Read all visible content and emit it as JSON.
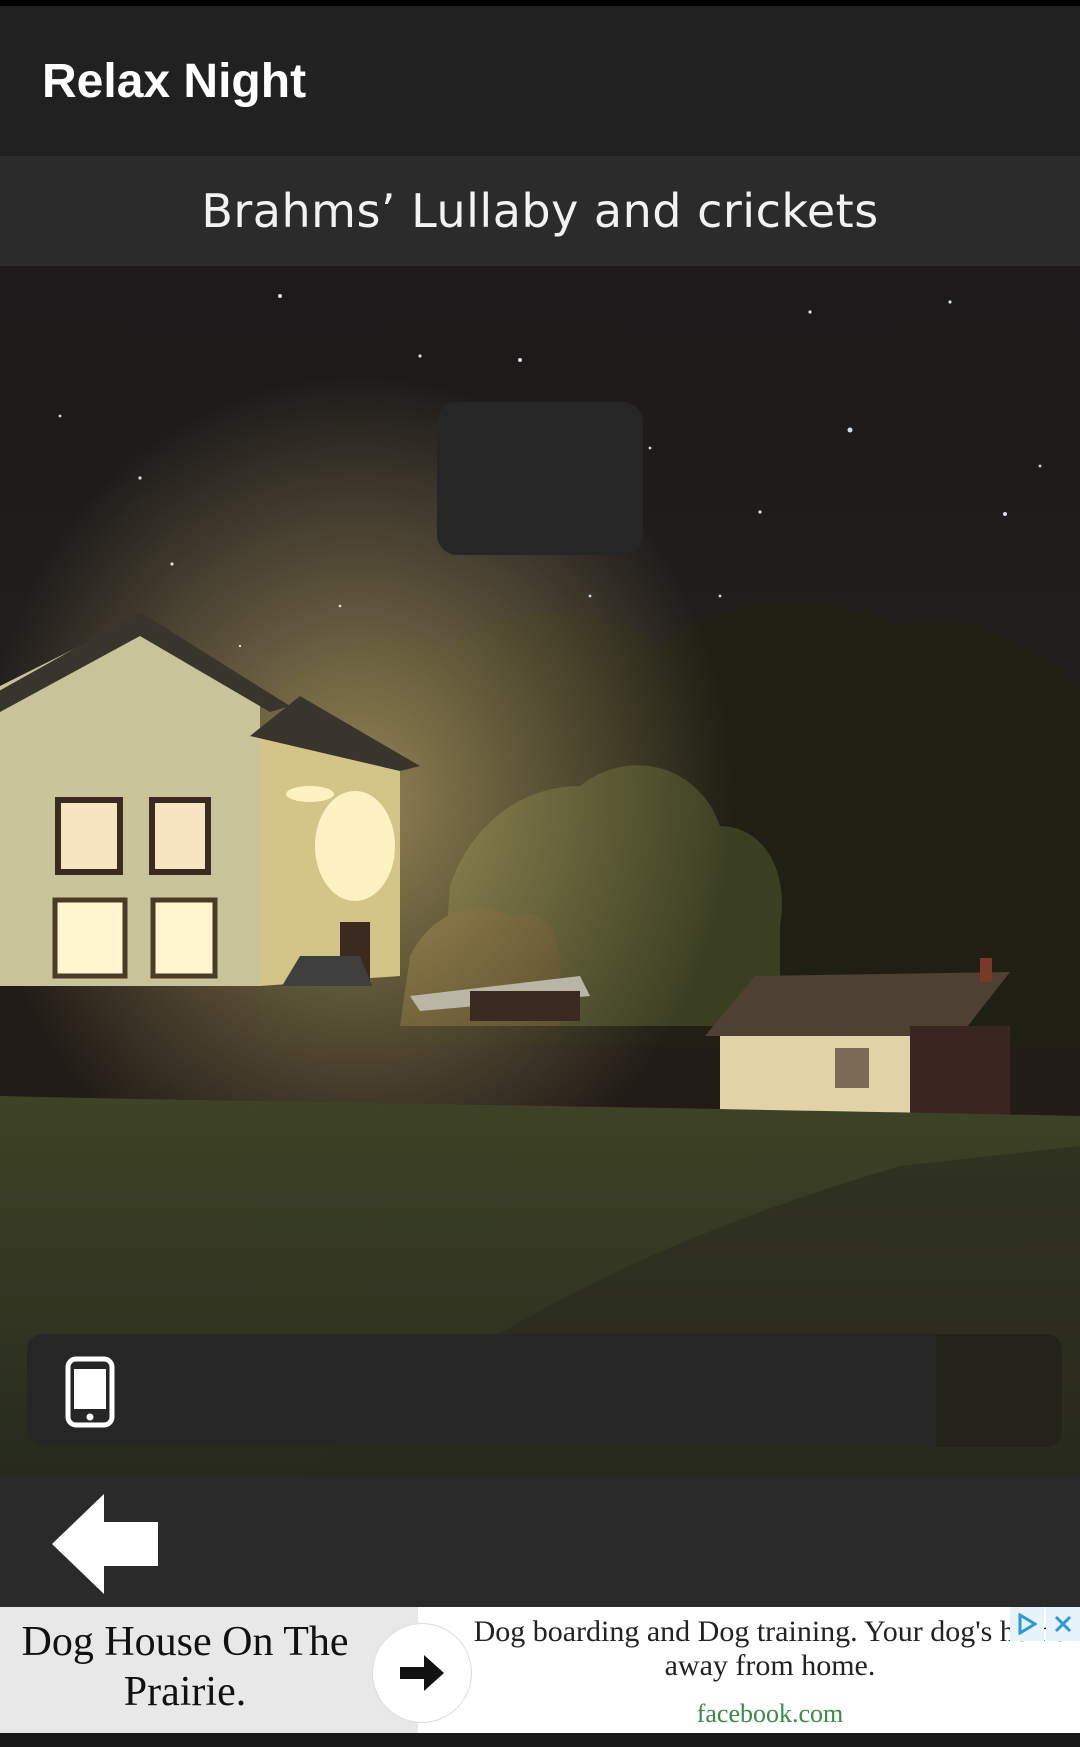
{
  "app": {
    "title": "Relax Night"
  },
  "track": {
    "title": "Brahms’ Lullaby and crickets"
  },
  "icons": {
    "phone": "phone-icon",
    "back": "back-arrow-icon",
    "ad_arrow": "arrow-right-icon",
    "ad_choices": "ad-choices-icon",
    "ad_close": "close-icon"
  },
  "ad": {
    "headline": "Dog House On The Prairie.",
    "body": "Dog boarding and Dog training. Your dog's home away from home.",
    "domain": "facebook.com"
  },
  "colors": {
    "appbar": "#212121",
    "track_bar": "#2b2b2b",
    "nav_bar": "#2a2a2a",
    "ad_domain": "#3a8a4a"
  }
}
